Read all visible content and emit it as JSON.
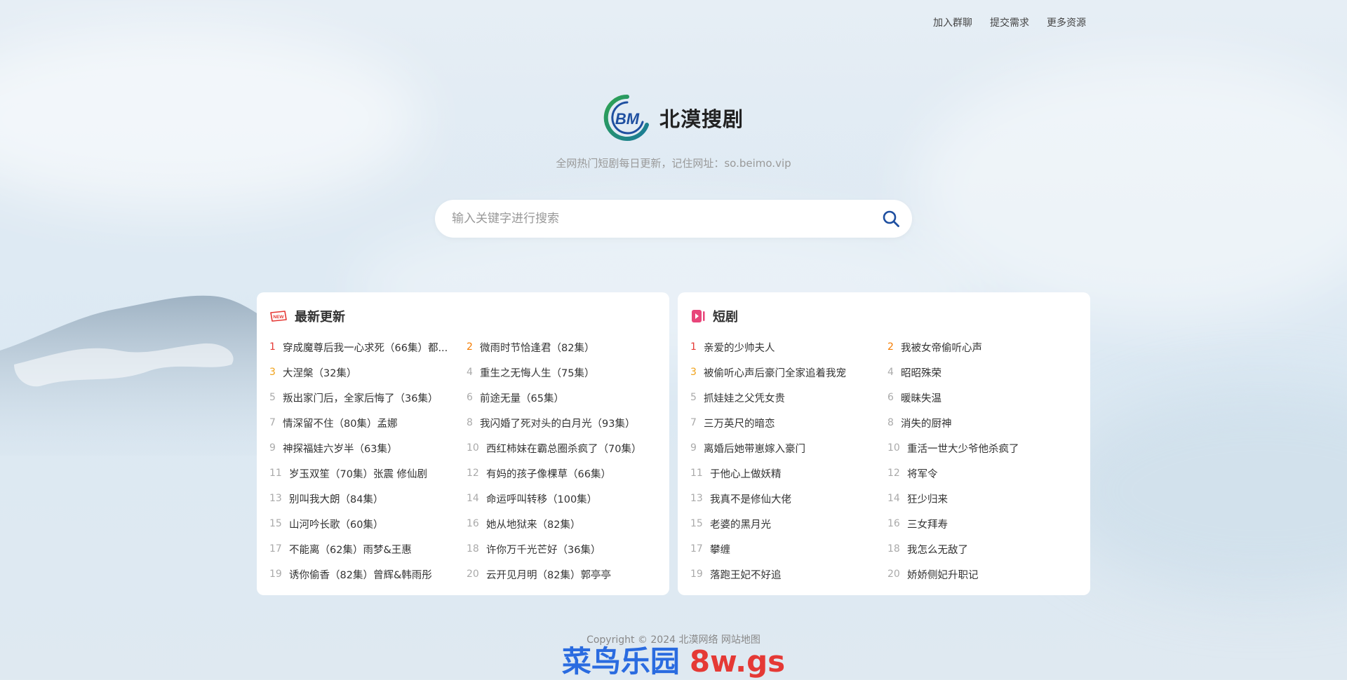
{
  "topnav": [
    {
      "label": "加入群聊"
    },
    {
      "label": "提交需求"
    },
    {
      "label": "更多资源"
    }
  ],
  "brand": {
    "name": "北漠搜剧",
    "logo_text": "BM",
    "tagline": "全网热门短剧每日更新，记住网址：so.beimo.vip"
  },
  "search": {
    "placeholder": "输入关键字进行搜索"
  },
  "panels": {
    "latest": {
      "title": "最新更新",
      "items": [
        {
          "num": "1",
          "text": "穿成魔尊后我一心求死（66集）都..."
        },
        {
          "num": "2",
          "text": "微雨时节恰逢君（82集）"
        },
        {
          "num": "3",
          "text": "大涅槃（32集）"
        },
        {
          "num": "4",
          "text": "重生之无悔人生（75集）"
        },
        {
          "num": "5",
          "text": "叛出家门后，全家后悔了（36集）"
        },
        {
          "num": "6",
          "text": "前途无量（65集）"
        },
        {
          "num": "7",
          "text": "情深留不住（80集）孟娜"
        },
        {
          "num": "8",
          "text": "我闪婚了死对头的白月光（93集）"
        },
        {
          "num": "9",
          "text": "神探福娃六岁半（63集）"
        },
        {
          "num": "10",
          "text": "西红柿妹在霸总圈杀疯了（70集）"
        },
        {
          "num": "11",
          "text": "岁玉双笙（70集）张震 修仙剧"
        },
        {
          "num": "12",
          "text": "有妈的孩子像棵草（66集）"
        },
        {
          "num": "13",
          "text": "别叫我大朗（84集）"
        },
        {
          "num": "14",
          "text": "命运呼叫转移（100集）"
        },
        {
          "num": "15",
          "text": "山河吟长歌（60集）"
        },
        {
          "num": "16",
          "text": "她从地狱来（82集）"
        },
        {
          "num": "17",
          "text": "不能离（62集）雨梦&王惠"
        },
        {
          "num": "18",
          "text": "许你万千光芒好（36集）"
        },
        {
          "num": "19",
          "text": "诱你偷香（82集）曾辉&韩雨彤"
        },
        {
          "num": "20",
          "text": "云开见月明（82集）郭亭亭"
        }
      ]
    },
    "short": {
      "title": "短剧",
      "items": [
        {
          "num": "1",
          "text": "亲爱的少帅夫人"
        },
        {
          "num": "2",
          "text": "我被女帝偷听心声"
        },
        {
          "num": "3",
          "text": "被偷听心声后豪门全家追着我宠"
        },
        {
          "num": "4",
          "text": "昭昭殊荣"
        },
        {
          "num": "5",
          "text": "抓娃娃之父凭女贵"
        },
        {
          "num": "6",
          "text": "暖昧失温"
        },
        {
          "num": "7",
          "text": "三万英尺的暗恋"
        },
        {
          "num": "8",
          "text": "消失的厨神"
        },
        {
          "num": "9",
          "text": "离婚后她带崽嫁入豪门"
        },
        {
          "num": "10",
          "text": "重活一世大少爷他杀疯了"
        },
        {
          "num": "11",
          "text": "于他心上做妖精"
        },
        {
          "num": "12",
          "text": "将军令"
        },
        {
          "num": "13",
          "text": "我真不是修仙大佬"
        },
        {
          "num": "14",
          "text": "狂少归来"
        },
        {
          "num": "15",
          "text": "老婆的黑月光"
        },
        {
          "num": "16",
          "text": "三女拜寿"
        },
        {
          "num": "17",
          "text": "攀缠"
        },
        {
          "num": "18",
          "text": "我怎么无敌了"
        },
        {
          "num": "19",
          "text": "落跑王妃不好追"
        },
        {
          "num": "20",
          "text": "娇娇侧妃升职记"
        }
      ]
    }
  },
  "footer": {
    "copyright": "Copyright © 2024 ",
    "company": "北漠网络",
    "sitemap": "网站地图"
  },
  "watermark": {
    "part1": "菜鸟乐园",
    "part2": "8w.gs"
  },
  "colors": {
    "rank1": "#e53935",
    "rank2": "#f57c00",
    "rank3": "#f0a21a",
    "search_icon": "#1e4fa0"
  }
}
